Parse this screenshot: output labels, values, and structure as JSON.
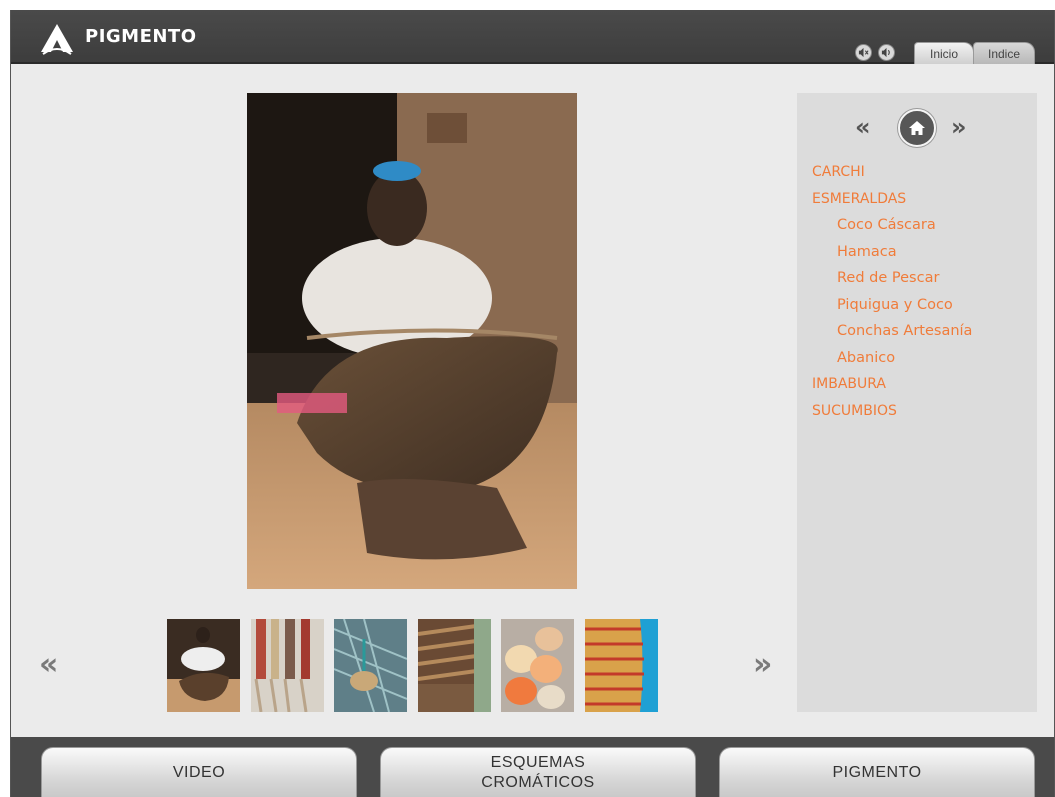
{
  "header": {
    "brand": "PIGMENTO",
    "icons": [
      "mute-icon",
      "volume-icon"
    ],
    "tabs": [
      {
        "label": "Inicio"
      },
      {
        "label": "Indice"
      }
    ]
  },
  "gallery": {
    "main_image": "coconut-shell-bowl-photo",
    "thumbnails": [
      "coconut-shell-thumbnail",
      "hammock-thumbnail",
      "fishing-net-thumbnail",
      "woven-basket-thumbnail",
      "seashells-thumbnail",
      "woven-fan-thumbnail"
    ],
    "prev_label": "«",
    "next_label": "»"
  },
  "sidebar": {
    "prev_label": "«",
    "next_label": "»",
    "items": [
      {
        "label": "CARCHI",
        "level": 0
      },
      {
        "label": "ESMERALDAS",
        "level": 0
      },
      {
        "label": "Coco Cáscara",
        "level": 1
      },
      {
        "label": "Hamaca",
        "level": 1
      },
      {
        "label": "Red de Pescar",
        "level": 1
      },
      {
        "label": "Piquigua y Coco",
        "level": 1
      },
      {
        "label": "Conchas Artesanía",
        "level": 1
      },
      {
        "label": "Abanico",
        "level": 1
      },
      {
        "label": "IMBABURA",
        "level": 0
      },
      {
        "label": "SUCUMBIOS",
        "level": 0
      }
    ]
  },
  "footer": {
    "video": "VIDEO",
    "esquemas_line1": "ESQUEMAS",
    "esquemas_line2": "CROMÁTICOS",
    "pigmento": "PIGMENTO"
  },
  "colors": {
    "accent": "#f07c3a",
    "header_bg": "#454545",
    "panel_bg": "#dcdcdc"
  }
}
